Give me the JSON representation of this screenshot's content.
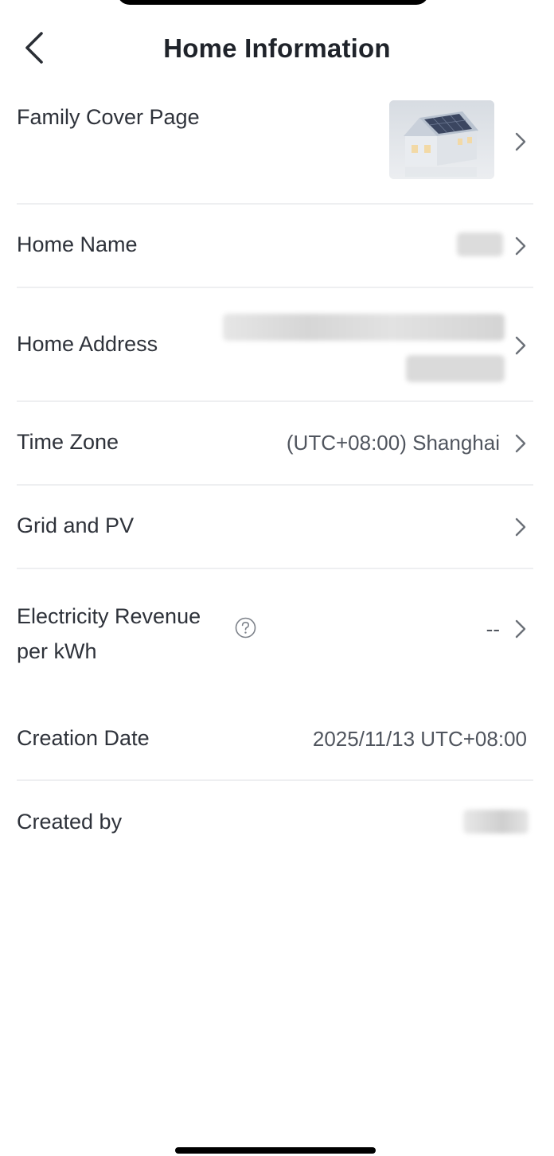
{
  "header": {
    "title": "Home Information"
  },
  "rows": {
    "cover": {
      "label": "Family Cover Page"
    },
    "name": {
      "label": "Home Name"
    },
    "address": {
      "label": "Home Address"
    },
    "timezone": {
      "label": "Time Zone",
      "value": "(UTC+08:00) Shanghai"
    },
    "grid": {
      "label": "Grid and PV"
    },
    "revenue": {
      "label_line1": "Electricity Revenue",
      "label_line2": "per kWh",
      "value": "--"
    },
    "creation": {
      "label": "Creation Date",
      "value": "2025/11/13 UTC+08:00"
    },
    "creator": {
      "label": "Created by"
    }
  },
  "icons": {
    "back": "chevron-left-icon",
    "chevron": "chevron-right-icon",
    "help": "question-circle-icon"
  },
  "colors": {
    "text_primary": "#2e323a",
    "text_secondary": "#50555e",
    "divider": "#eeeff1",
    "chevron": "#6b7078"
  }
}
